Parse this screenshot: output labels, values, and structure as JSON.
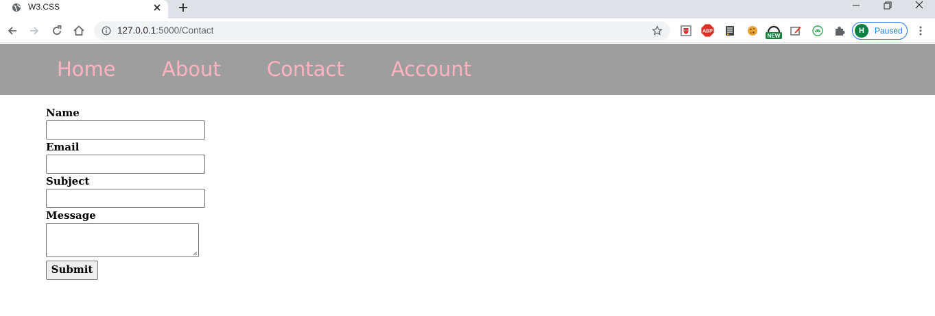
{
  "browser": {
    "tab": {
      "title": "W3.CSS",
      "favicon": "globe-icon"
    },
    "url": {
      "host": "127.0.0.1",
      "rest": ":5000/Contact"
    },
    "profile": {
      "initial": "H",
      "status": "Paused"
    },
    "extensions": [
      "shield-extension-icon",
      "adblock-extension-icon",
      "list-extension-icon",
      "cookie-extension-icon",
      "new-extension-icon",
      "edit-extension-icon",
      "android-extension-icon",
      "puzzle-icon"
    ],
    "extension_badge": "NEW",
    "adblock_label": "ABP"
  },
  "nav": {
    "items": [
      {
        "label": "Home"
      },
      {
        "label": "About"
      },
      {
        "label": "Contact"
      },
      {
        "label": "Account"
      }
    ],
    "bar_color": "#9e9e9e",
    "link_color": "#ffb3c1"
  },
  "form": {
    "name_label": "Name",
    "email_label": "Email",
    "subject_label": "Subject",
    "message_label": "Message",
    "name_value": "",
    "email_value": "",
    "subject_value": "",
    "message_value": "",
    "submit_label": "Submit"
  }
}
